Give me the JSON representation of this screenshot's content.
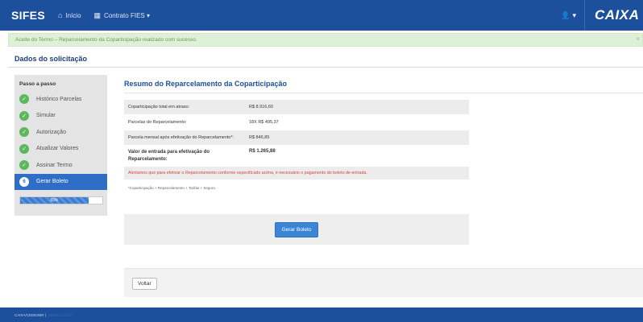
{
  "navbar": {
    "brand": "SIFES",
    "home_label": "Início",
    "contract_label": "Contrato FIES ▾",
    "user_label": "▾",
    "logo_text": "CAIXA"
  },
  "alert": {
    "message": "Aceite do Termo – Reparcelamento da Coparticipação realizado com sucesso.",
    "close": "×"
  },
  "page": {
    "title": "Dados do solicitação"
  },
  "sidebar": {
    "title": "Passo a passo",
    "steps": [
      {
        "label": "Histórico Parcelas",
        "status": "done"
      },
      {
        "label": "Simular",
        "status": "done"
      },
      {
        "label": "Autorização",
        "status": "done"
      },
      {
        "label": "Atualizar Valores",
        "status": "done"
      },
      {
        "label": "Assinar Termo",
        "status": "done"
      },
      {
        "label": "Gerar Boleto",
        "status": "active",
        "number": "6"
      }
    ],
    "progress": {
      "value_percent": 83,
      "label": "83%"
    }
  },
  "main": {
    "title": "Resumo do Reparcelamento da Coparticipação",
    "rows": [
      {
        "label": "Coparticipação total em atraso:",
        "value": "R$ 8.916,60"
      },
      {
        "label": "Parcelas do Reparcelamento:",
        "value": "18X R$ 495,37"
      },
      {
        "label": "Parcela mensal após efetivação do Reparcelamento*:",
        "value": "R$ 846,85"
      },
      {
        "label": "Valor de entrada para efetivação do Reparcelamento:",
        "value": "R$ 1.265,88"
      }
    ],
    "warning": "Alertamos que para efetivar o Reparcelamento conforme especificado acima, é necessário o pagamento do boleto de entrada.",
    "footnote": "*Coparticipação + Reparcelamento + Tarifas + Seguro.",
    "generate_button": "Gerar Boleto",
    "back_button": "Voltar"
  },
  "footer": {
    "text": "CAIXA/CEDESBR |",
    "link": "Versão 1.0.0.0"
  },
  "colors": {
    "primary": "#1c4f9c",
    "success": "#5cb85c",
    "danger": "#d9453e",
    "alert_bg": "#dff0d8"
  },
  "icons": {
    "home": "home-icon",
    "grid": "grid-icon",
    "user": "user-icon",
    "check": "check-icon"
  }
}
